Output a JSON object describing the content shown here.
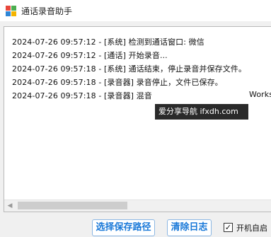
{
  "window": {
    "title": "通话录音助手",
    "icon": "app-logo-icon"
  },
  "log": {
    "lines": [
      "2024-07-26 09:57:12 - [系统] 检测到通话窗口: 微信",
      "2024-07-26 09:57:12 - [通话] 开始录音...",
      "2024-07-26 09:57:18 - [系统] 通话结束，停止录音并保存文件。",
      "2024-07-26 09:57:18 - [录音器] 录音停止，文件已保存。",
      "2024-07-26 09:57:18 - [录音器] 混音"
    ],
    "line5_tail": "Works"
  },
  "overlay": {
    "watermark": "爱分享导航  ifxdh.com"
  },
  "buttons": {
    "save_path": "选择保存路径",
    "clear_log": "清除日志"
  },
  "autostart": {
    "label": "开机自启",
    "checked": true,
    "check_mark": "✓"
  },
  "colors": {
    "button_text": "#1878d8",
    "icon_red": "#e8473c",
    "icon_green": "#4cae50",
    "icon_blue": "#2f86d6",
    "icon_yellow": "#f4b400"
  }
}
